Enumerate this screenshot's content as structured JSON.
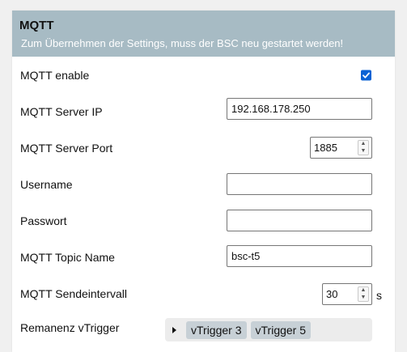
{
  "header": {
    "title": "MQTT",
    "subtitle": "Zum Übernehmen der Settings, muss der BSC neu gestartet werden!"
  },
  "colors": {
    "header_bg": "#a7bbc4",
    "checkbox_accent": "#0b63d4"
  },
  "fields": {
    "mqtt_enable": {
      "label": "MQTT enable",
      "checked": true
    },
    "server_ip": {
      "label": "MQTT Server IP",
      "value": "192.168.178.250"
    },
    "server_port": {
      "label": "MQTT Server Port",
      "value": "1885"
    },
    "username": {
      "label": "Username",
      "value": ""
    },
    "password": {
      "label": "Passwort",
      "value": ""
    },
    "topic_name": {
      "label": "MQTT Topic Name",
      "value": "bsc-t5"
    },
    "send_interval": {
      "label": "MQTT Sendeintervall",
      "value": "30",
      "unit": "s"
    },
    "remanenz": {
      "label": "Remanenz vTrigger",
      "selected": [
        "vTrigger 3",
        "vTrigger 5"
      ]
    }
  },
  "icons": {
    "checkbox": "check-icon",
    "spinner_up": "spin-up-icon",
    "spinner_down": "spin-down-icon",
    "expand": "caret-right-icon"
  }
}
